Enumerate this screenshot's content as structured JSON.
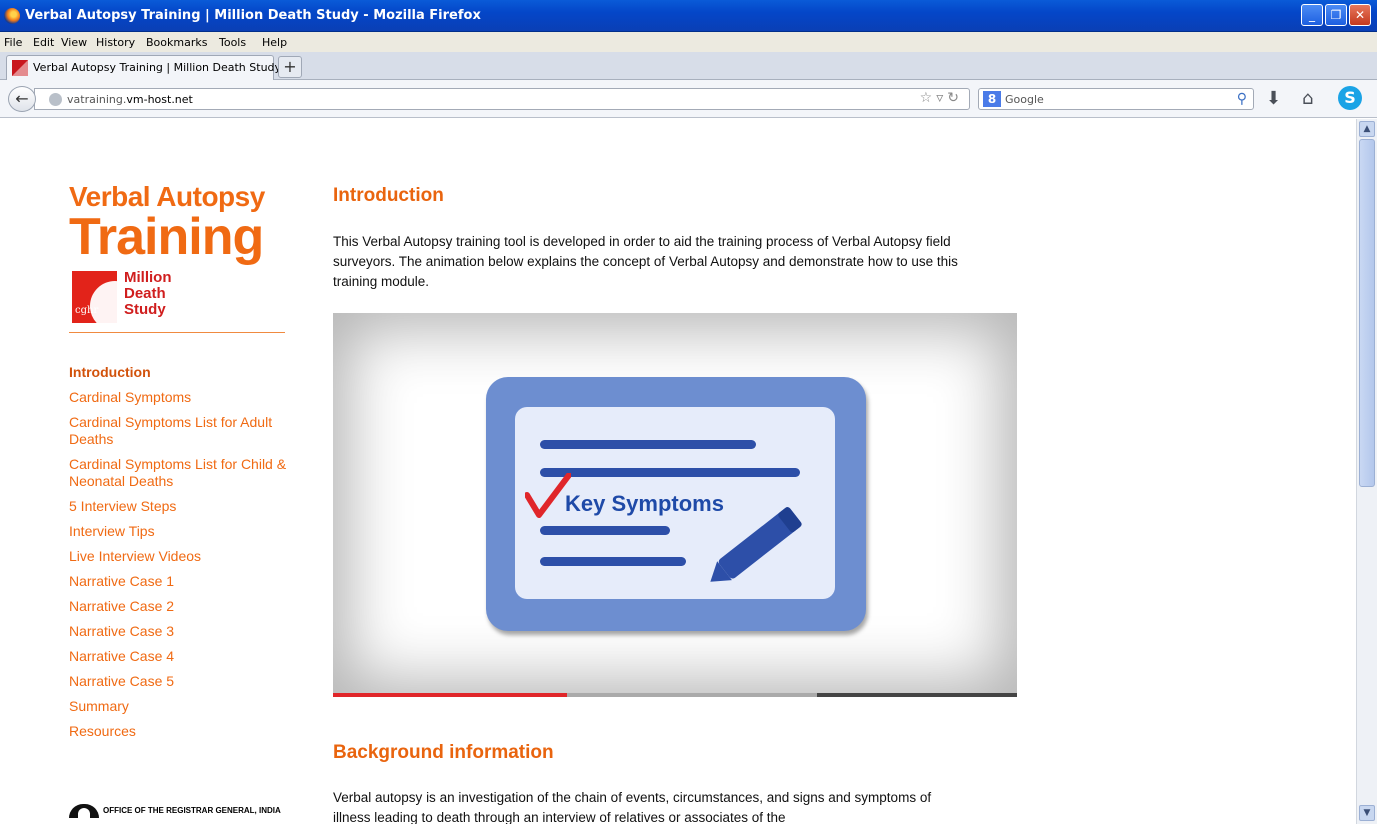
{
  "window": {
    "title": "Verbal Autopsy Training | Million Death Study - Mozilla Firefox",
    "buttons": {
      "minimize": "_",
      "maximize": "❐",
      "close": "✕"
    }
  },
  "menu": [
    "File",
    "Edit",
    "View",
    "History",
    "Bookmarks",
    "Tools",
    "Help"
  ],
  "tab": {
    "label": "Verbal Autopsy Training | Million Death Study",
    "new_tab": "+"
  },
  "navbar": {
    "url_prefix": "vatraining.",
    "url_domain": "vm-host.net",
    "search_placeholder": "Google"
  },
  "sidebar": {
    "logo_line1": "Verbal Autopsy",
    "logo_line2": "Training",
    "cghr": "cghr",
    "mds": [
      "Million",
      "Death",
      "Study"
    ],
    "nav": [
      {
        "label": "Introduction",
        "active": true
      },
      {
        "label": "Cardinal Symptoms"
      },
      {
        "label": "Cardinal Symptoms List for Adult Deaths"
      },
      {
        "label": "Cardinal Symptoms List for Child & Neonatal Deaths"
      },
      {
        "label": "5 Interview Steps"
      },
      {
        "label": "Interview Tips"
      },
      {
        "label": "Live Interview Videos"
      },
      {
        "label": "Narrative Case 1"
      },
      {
        "label": "Narrative Case 2"
      },
      {
        "label": "Narrative Case 3"
      },
      {
        "label": "Narrative Case 4"
      },
      {
        "label": "Narrative Case 5"
      },
      {
        "label": "Summary"
      },
      {
        "label": "Resources"
      }
    ],
    "org": "OFFICE OF THE REGISTRAR GENERAL, INDIA"
  },
  "main": {
    "intro_heading": "Introduction",
    "intro_text": "This Verbal Autopsy training tool is developed in order to aid the training process of Verbal Autopsy field surveyors. The animation below explains the concept of Verbal Autopsy and demonstrate how to use this training module.",
    "video_card_text": "Key Symptoms",
    "video_progress_played": 0.34,
    "video_progress_buffered": 0.71,
    "bg_heading": "Background information",
    "bg_text": "Verbal autopsy is an investigation of the chain of events, circumstances, and signs and symptoms of illness leading to death through an interview of relatives or associates of the"
  },
  "colors": {
    "accent": "#f06a13",
    "titlebar": "#0446c8",
    "card": "#6d8ed0"
  }
}
